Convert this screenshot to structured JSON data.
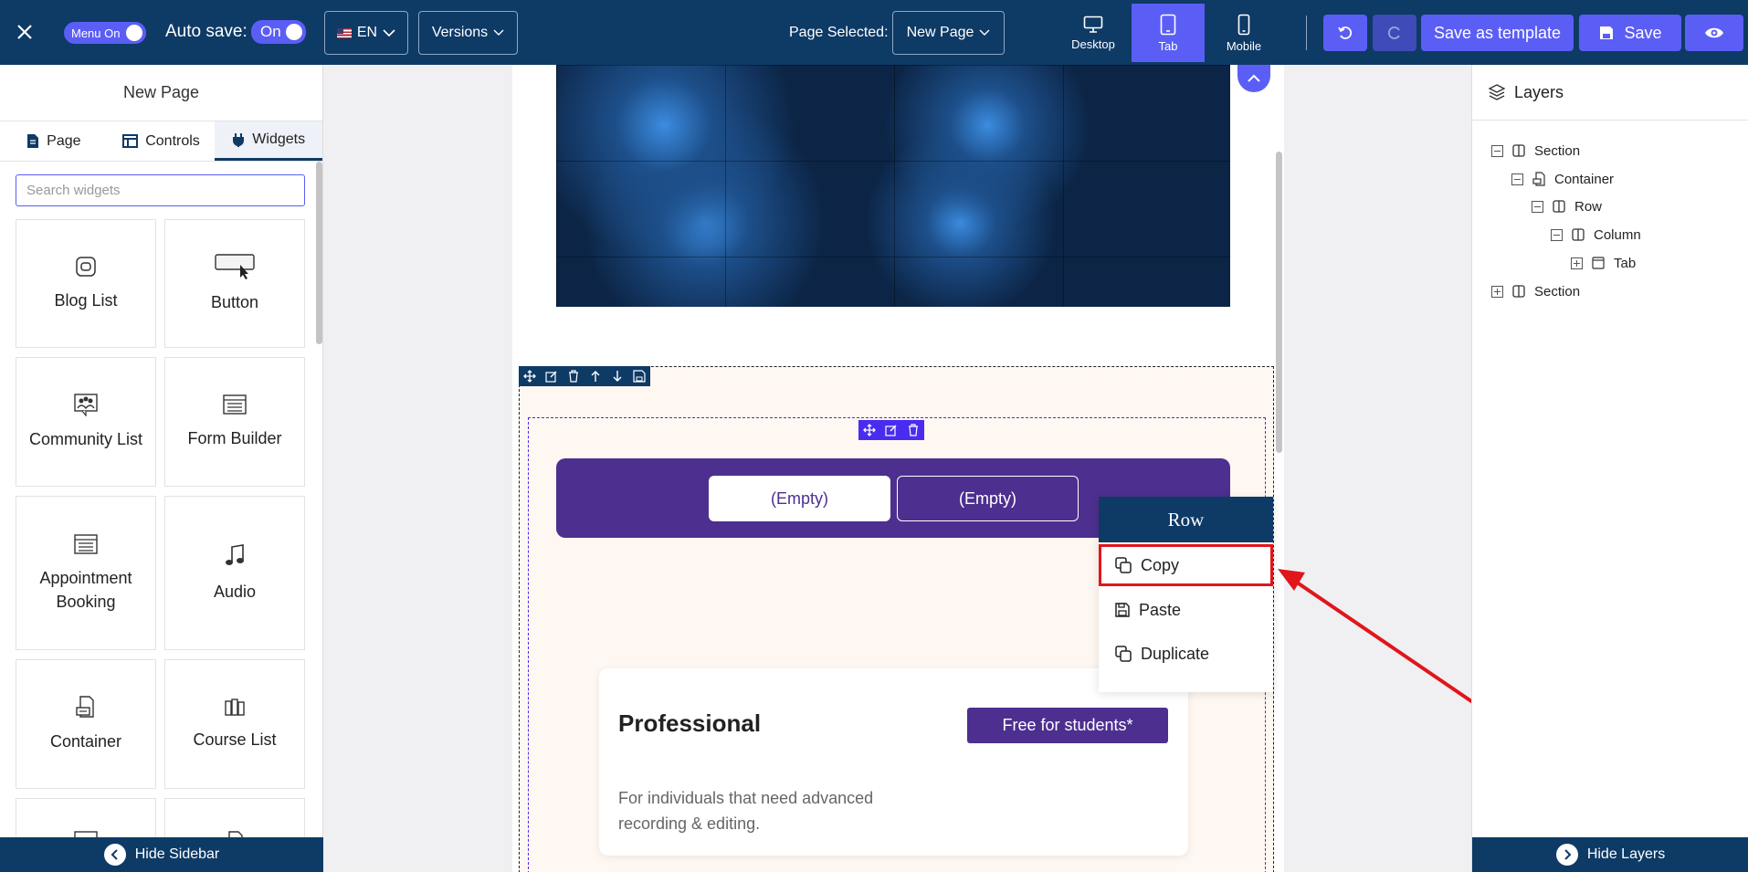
{
  "topbar": {
    "menu_toggle_label": "Menu On",
    "autosave_label": "Auto save:",
    "autosave_toggle_label": "On",
    "language": "EN",
    "versions_label": "Versions",
    "page_selected_label": "Page Selected:",
    "page_selected_value": "New Page",
    "devices": [
      {
        "label": "Desktop",
        "active": false
      },
      {
        "label": "Tab",
        "active": true
      },
      {
        "label": "Mobile",
        "active": false
      }
    ],
    "save_template_label": "Save as template",
    "save_label": "Save",
    "accent_color": "#5b5ef5",
    "bar_color": "#0e3a66"
  },
  "left_sidebar": {
    "title": "New Page",
    "tabs": [
      {
        "label": "Page",
        "icon": "document-icon"
      },
      {
        "label": "Controls",
        "icon": "table-icon"
      },
      {
        "label": "Widgets",
        "icon": "plug-icon",
        "active": true
      }
    ],
    "search_placeholder": "Search widgets",
    "widgets": [
      {
        "label": "Blog List",
        "icon": "blog-icon"
      },
      {
        "label": "Button",
        "icon": "button-cursor-icon"
      },
      {
        "label": "Community List",
        "icon": "community-icon"
      },
      {
        "label": "Form Builder",
        "icon": "form-icon"
      },
      {
        "label": "Appointment Booking",
        "icon": "calendar-icon"
      },
      {
        "label": "Audio",
        "icon": "music-note-icon"
      },
      {
        "label": "Container",
        "icon": "container-icon"
      },
      {
        "label": "Course List",
        "icon": "books-icon"
      }
    ],
    "hide_label": "Hide Sidebar"
  },
  "canvas": {
    "tabs": [
      "(Empty)",
      "(Empty)"
    ],
    "card": {
      "title": "Professional",
      "badge": "Free for students*",
      "description": "For individuals that need advanced recording & editing."
    },
    "tab_bar_color": "#4d2f8f"
  },
  "context_menu": {
    "title": "Row",
    "items": [
      {
        "label": "Copy",
        "icon": "copy-icon",
        "highlighted": true
      },
      {
        "label": "Paste",
        "icon": "save-icon"
      },
      {
        "label": "Duplicate",
        "icon": "duplicate-icon"
      }
    ],
    "highlight_color": "#e0161b"
  },
  "layers": {
    "title": "Layers",
    "items": [
      {
        "label": "Section",
        "depth": 0,
        "expanded": true,
        "icon": "columns-icon"
      },
      {
        "label": "Container",
        "depth": 1,
        "expanded": true,
        "icon": "container-icon"
      },
      {
        "label": "Row",
        "depth": 2,
        "expanded": true,
        "icon": "columns-icon"
      },
      {
        "label": "Column",
        "depth": 3,
        "expanded": true,
        "icon": "columns-icon"
      },
      {
        "label": "Tab",
        "depth": 4,
        "expanded": false,
        "icon": "window-icon"
      },
      {
        "label": "Section",
        "depth": 0,
        "expanded": false,
        "icon": "columns-icon"
      }
    ],
    "hide_label": "Hide Layers"
  }
}
